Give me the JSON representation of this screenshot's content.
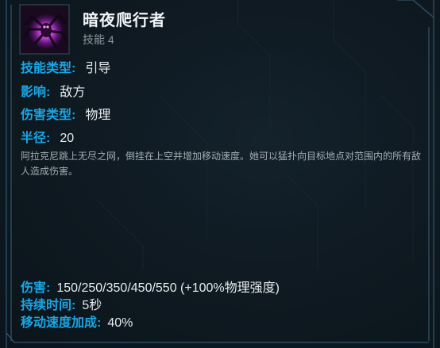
{
  "ability": {
    "name": "暗夜爬行者",
    "slot": "技能 4",
    "icon": "spider-ability-icon"
  },
  "stats": {
    "type_label": "技能类型:",
    "type_value": "引导",
    "affects_label": "影响:",
    "affects_value": "敌方",
    "damage_type_label": "伤害类型:",
    "damage_type_value": "物理",
    "radius_label": "半径:",
    "radius_value": "20"
  },
  "description": "阿拉克尼跳上无尽之网，倒挂在上空并增加移动速度。她可以猛扑向目标地点对范围内的所有敌人造成伤害。",
  "bottom_stats": {
    "damage_label": "伤害:",
    "damage_value": "150/250/350/450/550 (+100%物理强度)",
    "duration_label": "持续时间:",
    "duration_value": "5秒",
    "speed_label": "移动速度加成:",
    "speed_value": "40%"
  },
  "colors": {
    "label_blue": "#1aa7e6",
    "frame_line": "#2a4a5c",
    "background": "#0f1a22"
  }
}
